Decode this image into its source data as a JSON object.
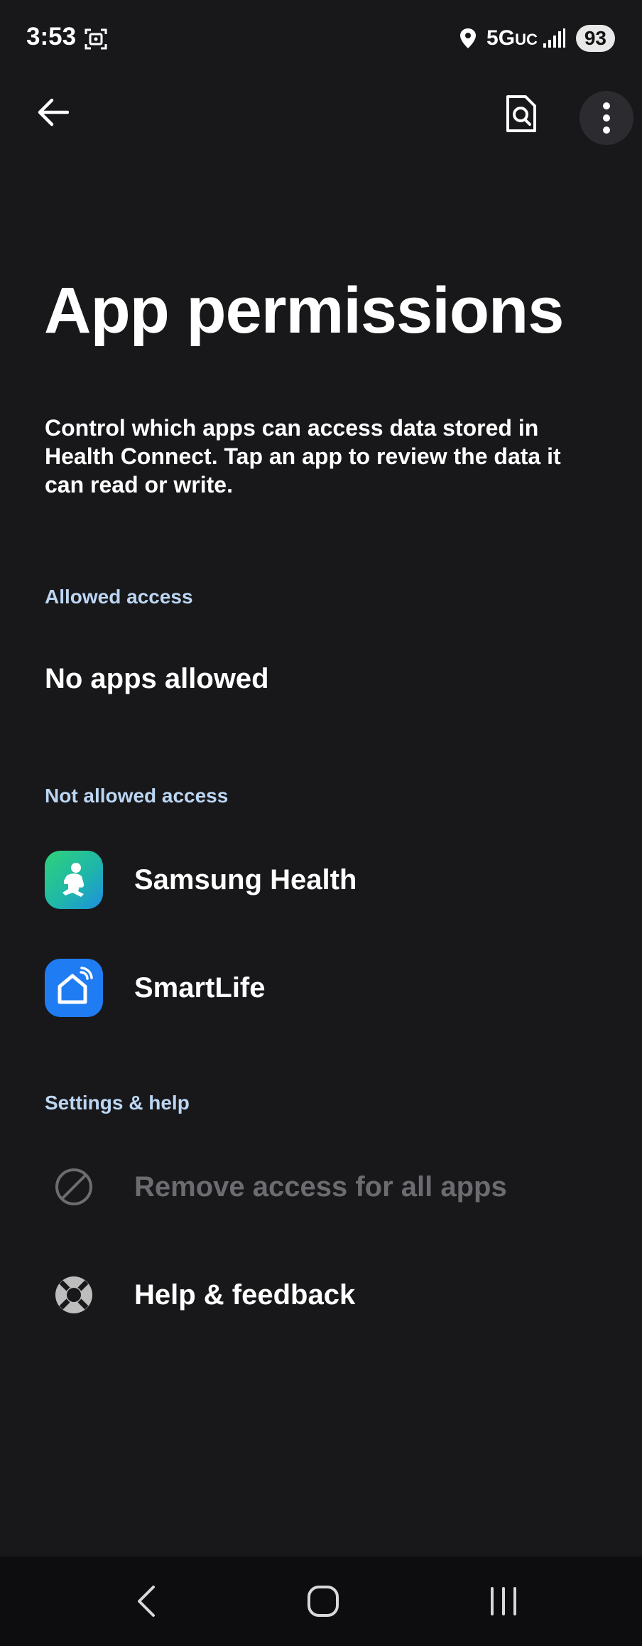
{
  "status_bar": {
    "time": "3:53",
    "network": "5G",
    "network_suffix": "UC",
    "battery": "93"
  },
  "app_bar": {
    "back_icon": "arrow-back-icon",
    "search_icon": "document-search-icon",
    "more_icon": "more-vertical-icon"
  },
  "page": {
    "title": "App permissions",
    "description": "Control which apps can access data stored in Health Connect. Tap an app to review the data it can read or write."
  },
  "allowed_section": {
    "header": "Allowed access",
    "empty_text": "No apps allowed"
  },
  "not_allowed_section": {
    "header": "Not allowed access",
    "apps": [
      {
        "name": "Samsung Health",
        "icon": "samsung-health-icon"
      },
      {
        "name": "SmartLife",
        "icon": "smartlife-icon"
      }
    ]
  },
  "settings_section": {
    "header": "Settings & help",
    "items": [
      {
        "label": "Remove access for all apps",
        "icon": "block-icon"
      },
      {
        "label": "Help & feedback",
        "icon": "help-lifebuoy-icon"
      }
    ]
  },
  "nav_bar": {
    "back_icon": "nav-back-icon",
    "home_icon": "nav-home-icon",
    "recents_icon": "nav-recents-icon"
  },
  "colors": {
    "background": "#18181b",
    "section_header": "#bcd6f2",
    "disabled_text": "#6c6c70",
    "nav_bar": "#0d0d10"
  }
}
